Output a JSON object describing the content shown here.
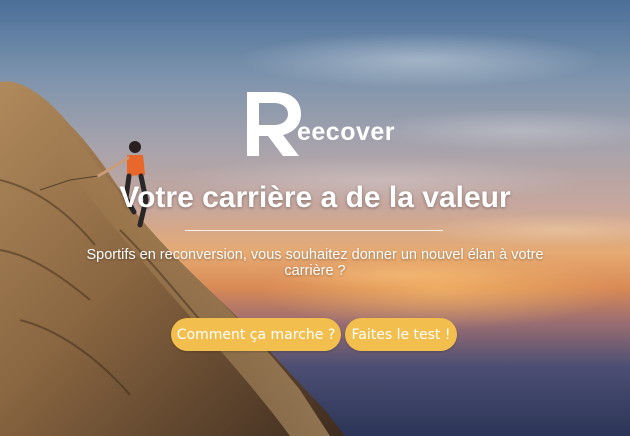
{
  "brand": {
    "logo_letter": "R",
    "wordmark": "eecover"
  },
  "hero": {
    "title": "Votre carrière a de la valeur",
    "subtitle": "Sportifs en reconversion, vous souhaitez donner un nouvel élan à votre carrière ?"
  },
  "actions": {
    "how_it_works": "Comment ça marche ?",
    "take_test": "Faites le test !"
  },
  "colors": {
    "button_bg": "#f2bf4e",
    "text": "#ffffff"
  }
}
